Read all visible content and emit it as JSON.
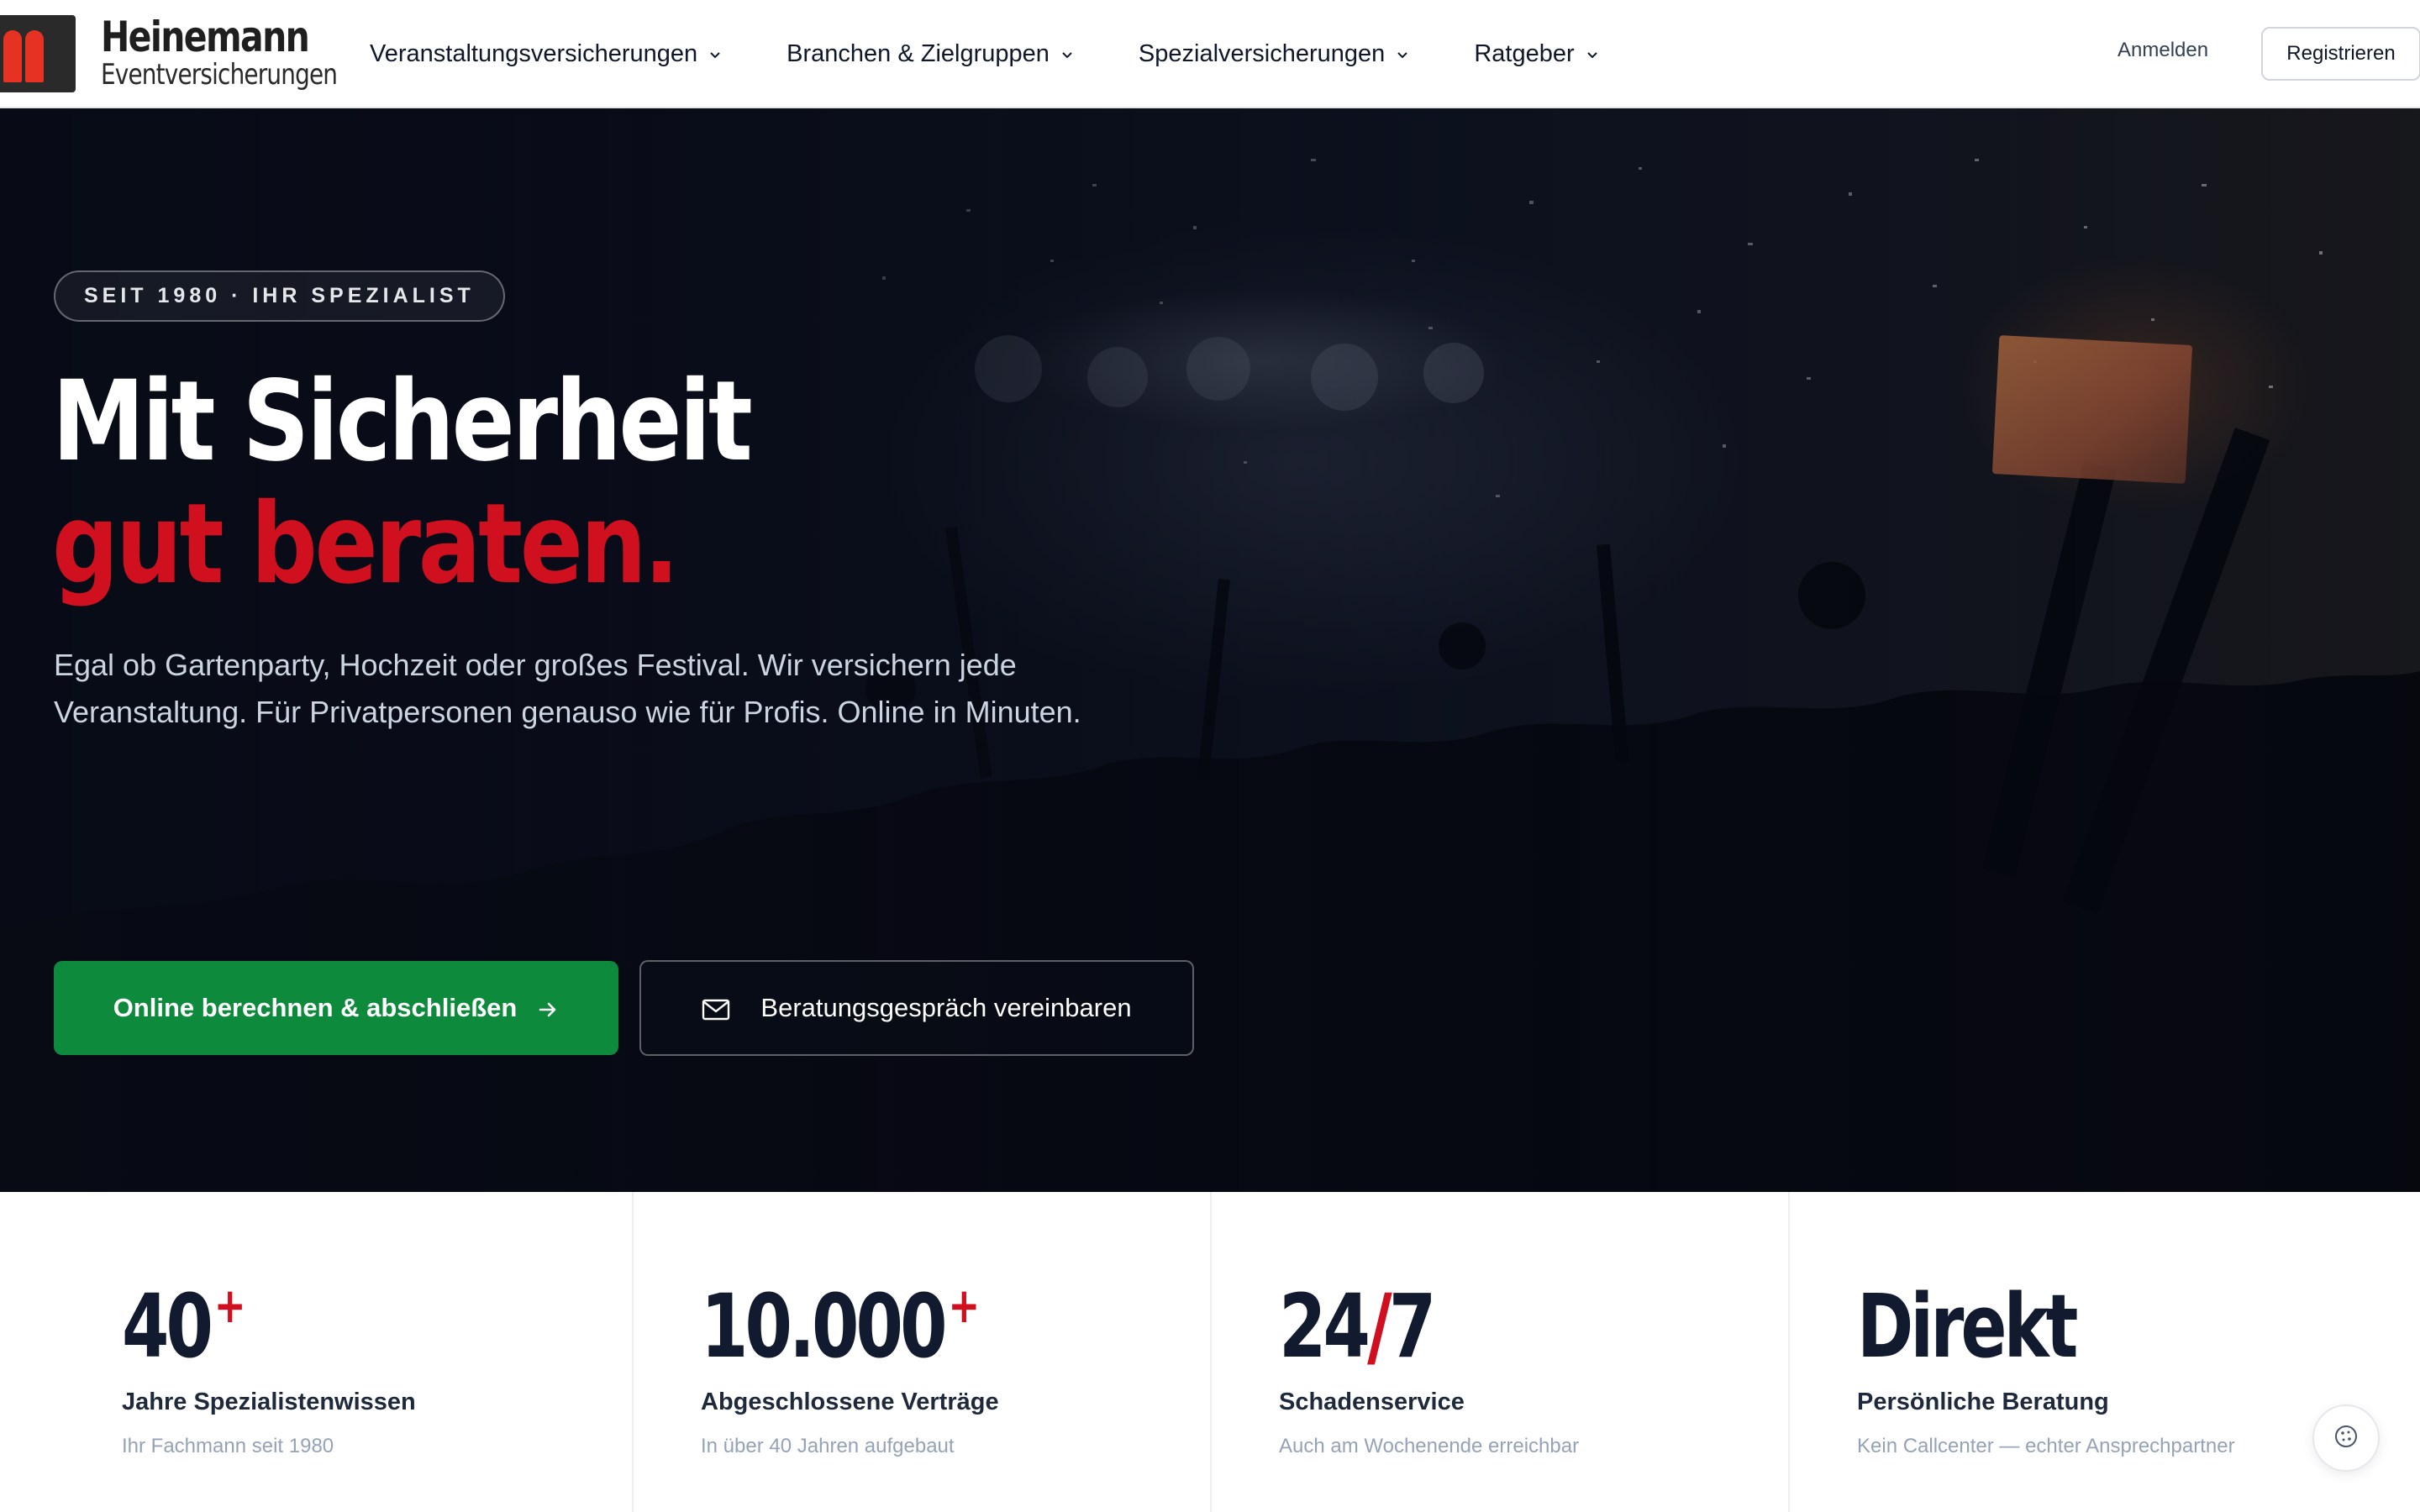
{
  "brand": {
    "name": "Heinemann",
    "subtitle": "Eventversicherungen",
    "accent": "#d0101f",
    "logo_color": "#e53222",
    "primary_green": "#0e8a3c"
  },
  "nav": {
    "items": [
      {
        "label": "Veranstaltungsversicherungen",
        "icon": "chevron-down-icon"
      },
      {
        "label": "Branchen & Zielgruppen",
        "icon": "chevron-down-icon"
      },
      {
        "label": "Spezialversicherungen",
        "icon": "chevron-down-icon"
      },
      {
        "label": "Ratgeber",
        "icon": "chevron-down-icon"
      }
    ],
    "login_label": "Anmelden",
    "register_label": "Registrieren"
  },
  "hero": {
    "badge": "SEIT 1980 · IHR SPEZIALIST",
    "headline_line1": "Mit Sicherheit",
    "headline_line2": "gut beraten.",
    "lead": "Egal ob Gartenparty, Hochzeit oder großes Festival. Wir versichern jede Veranstaltung. Für Privatpersonen genauso wie für Profis. Online in Minuten.",
    "cta_primary": "Online berechnen & abschließen",
    "cta_primary_icon": "arrow-right-icon",
    "cta_secondary": "Beratungsgespräch vereinbaren",
    "cta_secondary_icon": "mail-icon"
  },
  "stats": [
    {
      "value": "40",
      "suffix": "+",
      "label": "Jahre Spezialistenwissen",
      "note": "Ihr Fachmann seit 1980"
    },
    {
      "value": "10.000",
      "suffix": "+",
      "label": "Abgeschlossene Verträge",
      "note": "In über 40 Jahren aufgebaut"
    },
    {
      "value_a": "24",
      "value_sep": "/",
      "value_b": "7",
      "label": "Schadenservice",
      "note": "Auch am Wochenende erreichbar"
    },
    {
      "value": "Direkt",
      "label": "Persönliche Beratung",
      "note": "Kein Callcenter — echter Ansprechpartner"
    }
  ],
  "cookie_icon": "cookie-icon"
}
